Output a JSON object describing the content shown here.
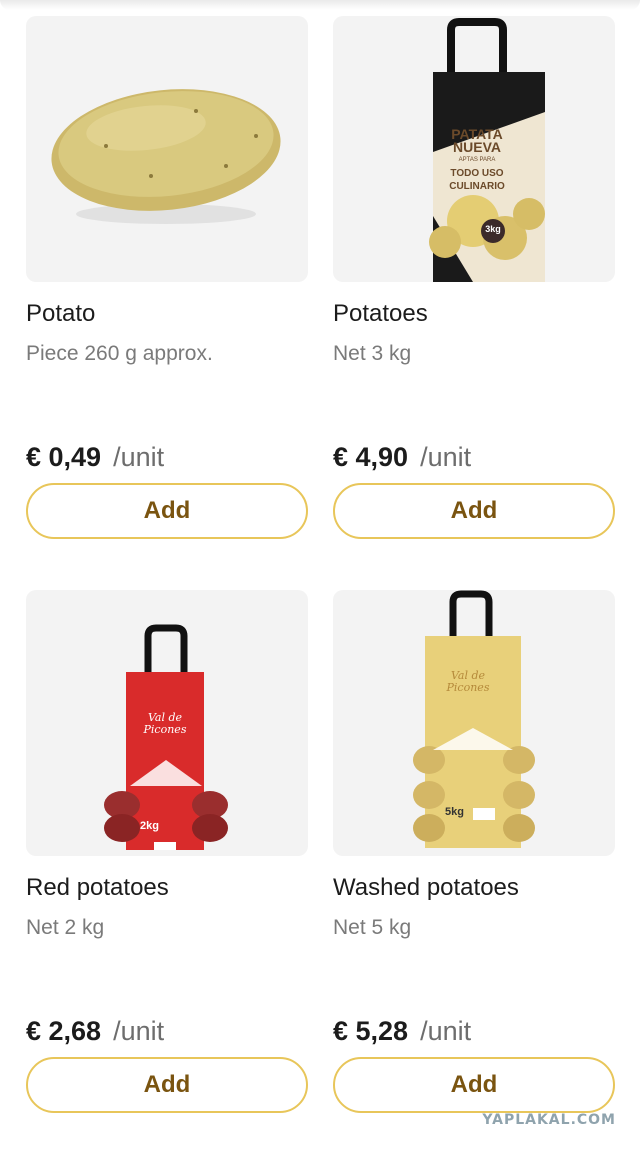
{
  "products": [
    {
      "name": "Potato",
      "desc": "Piece 260 g approx.",
      "price": "€ 0,49",
      "unit": "/unit",
      "add_label": "Add"
    },
    {
      "name": "Potatoes",
      "desc": "Net 3 kg",
      "price": "€ 4,90",
      "unit": "/unit",
      "add_label": "Add",
      "bag_text": [
        "PATATA",
        "NUEVA",
        "APTAS PARA",
        "TODO USO",
        "CULINARIO"
      ],
      "bag_weight": "3kg"
    },
    {
      "name": "Red potatoes",
      "desc": "Net 2 kg",
      "price": "€ 2,68",
      "unit": "/unit",
      "add_label": "Add",
      "bag_brand": "Val de Picones",
      "bag_weight": "2kg"
    },
    {
      "name": "Washed potatoes",
      "desc": "Net 5 kg",
      "price": "€ 5,28",
      "unit": "/unit",
      "add_label": "Add",
      "bag_brand": "Val de Picones",
      "bag_weight": "5kg"
    }
  ],
  "watermark": "YAPLAKAL.COM",
  "colors": {
    "add_border": "#e8c65a",
    "add_text": "#7a5410",
    "card_bg": "#f3f3f3"
  }
}
